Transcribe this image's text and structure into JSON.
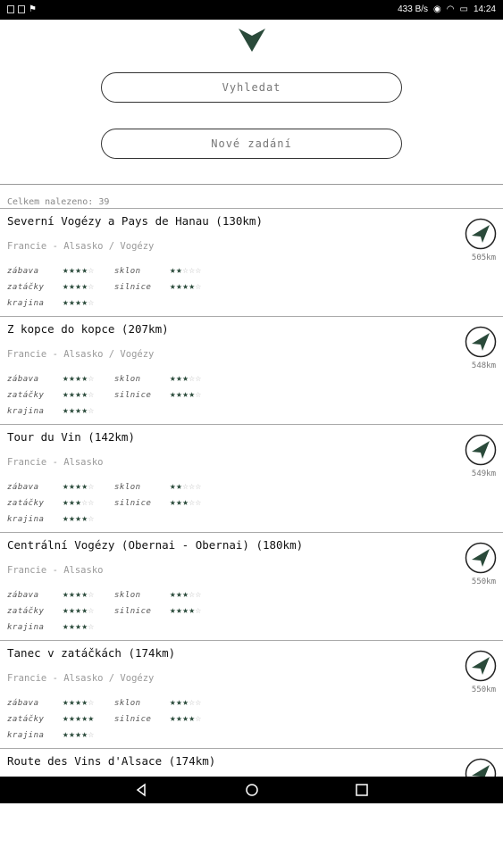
{
  "status": {
    "speed": "433 B/s",
    "battery": "100",
    "time": "14:24"
  },
  "buttons": {
    "search": "Vyhledat",
    "new": "Nové zadání"
  },
  "result_count": "Celkem nalezeno: 39",
  "labels": {
    "fun": "zábava",
    "slope": "sklon",
    "curves": "zatáčky",
    "roads": "silnice",
    "landscape": "krajina"
  },
  "colors": {
    "accent": "#2a4a3a"
  },
  "routes": [
    {
      "title": "Severní Vogézy a Pays de Hanau (130km)",
      "region": "Francie - Alsasko / Vogézy",
      "distance": "505km",
      "fun": 4,
      "slope": 2,
      "curves": 4,
      "roads": 4,
      "landscape": 4
    },
    {
      "title": "Z kopce do kopce (207km)",
      "region": "Francie - Alsasko / Vogézy",
      "distance": "548km",
      "fun": 4,
      "slope": 3,
      "curves": 4,
      "roads": 4,
      "landscape": 4
    },
    {
      "title": "Tour du Vin (142km)",
      "region": "Francie - Alsasko",
      "distance": "549km",
      "fun": 4,
      "slope": 2,
      "curves": 3,
      "roads": 3,
      "landscape": 4
    },
    {
      "title": "Centrální Vogézy (Obernai - Obernai) (180km)",
      "region": "Francie - Alsasko",
      "distance": "550km",
      "fun": 4,
      "slope": 3,
      "curves": 4,
      "roads": 4,
      "landscape": 4
    },
    {
      "title": "Tanec v zatáčkách (174km)",
      "region": "Francie - Alsasko / Vogézy",
      "distance": "550km",
      "fun": 4,
      "slope": 3,
      "curves": 5,
      "roads": 4,
      "landscape": 4
    },
    {
      "title": "Route des Vins d'Alsace (174km)",
      "region": "",
      "distance": "",
      "fun": 0,
      "slope": 0,
      "curves": 0,
      "roads": 0,
      "landscape": 0
    }
  ]
}
